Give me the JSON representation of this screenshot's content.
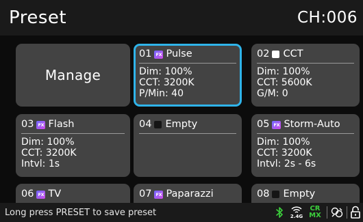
{
  "header": {
    "title": "Preset",
    "channel": "CH:006"
  },
  "manage_label": "Manage",
  "presets": [
    {
      "num": "01",
      "type": "fx",
      "name": "Pulse",
      "lines": [
        "Dim: 100%",
        "CCT: 3200K",
        "P/Min: 40"
      ],
      "selected": true
    },
    {
      "num": "02",
      "type": "cct",
      "name": "CCT",
      "lines": [
        "Dim: 100%",
        "CCT: 5600K",
        "G/M: 0"
      ]
    },
    {
      "num": "03",
      "type": "fx",
      "name": "Flash",
      "lines": [
        "Dim: 100%",
        "CCT: 3200K",
        "Intvl: 1s"
      ]
    },
    {
      "num": "04",
      "type": "empty",
      "name": "Empty",
      "lines": []
    },
    {
      "num": "05",
      "type": "fx",
      "name": "Storm-Auto",
      "lines": [
        "Dim: 100%",
        "CCT: 3200K",
        "Intvl: 2s - 6s"
      ]
    },
    {
      "num": "06",
      "type": "fx",
      "name": "TV",
      "lines": []
    },
    {
      "num": "07",
      "type": "fx",
      "name": "Paparazzi",
      "lines": []
    },
    {
      "num": "08",
      "type": "empty",
      "name": "Empty",
      "lines": []
    }
  ],
  "fx_badge": "FX",
  "status": {
    "message": "Long press PRESET to save preset",
    "wifi_band": "2.4G",
    "crmx_top": "CR",
    "crmx_bottom": "MX",
    "icons": [
      "bluetooth-icon",
      "wireless-2.4g-icon",
      "crmx-icon",
      "link-icon",
      "lock-icon"
    ]
  },
  "colors": {
    "background": "#0c0c0c",
    "tile": "#434343",
    "header_bar": "#1a1a1a",
    "selected_border": "#2fb4ea",
    "bluetooth": "#3ccf3c",
    "crmx": "#3ccf3c"
  }
}
